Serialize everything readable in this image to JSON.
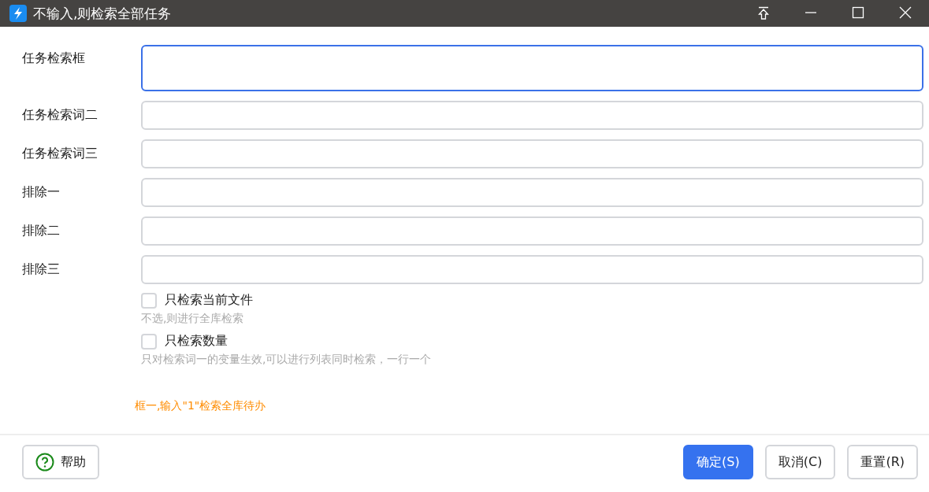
{
  "window": {
    "title": "不输入,则检索全部任务"
  },
  "fields": [
    {
      "label": "任务检索框",
      "focused": true,
      "multiline": true
    },
    {
      "label": "任务检索词二",
      "focused": false,
      "multiline": false
    },
    {
      "label": "任务检索词三",
      "focused": false,
      "multiline": false
    },
    {
      "label": "排除一",
      "focused": false,
      "multiline": false
    },
    {
      "label": "排除二",
      "focused": false,
      "multiline": false
    },
    {
      "label": "排除三",
      "focused": false,
      "multiline": false
    }
  ],
  "options": [
    {
      "label": "只检索当前文件",
      "checked": false,
      "hint": "不选,则进行全库检索"
    },
    {
      "label": "只检索数量",
      "checked": false,
      "hint": "只对检索词一的变量生效,可以进行列表同时检索，一行一个"
    }
  ],
  "note": "框一,输入\"1\"检索全库待办",
  "buttons": [
    {
      "label": "帮助",
      "kind": "help"
    },
    {
      "label": "确定(S)",
      "kind": "primary"
    },
    {
      "label": "取消(C)",
      "kind": "default"
    },
    {
      "label": "重置(R)",
      "kind": "default"
    }
  ]
}
